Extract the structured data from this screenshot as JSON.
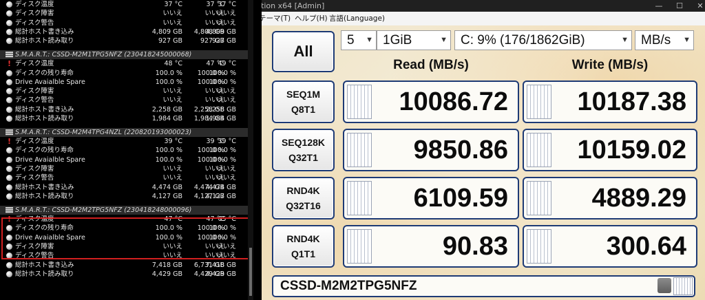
{
  "sensor_panel": {
    "top_rows": [
      {
        "icon": "gauge",
        "label": "ディスク温度",
        "v1": "37 °C",
        "v2": "37 °C",
        "v3": "37 °C"
      },
      {
        "icon": "gauge",
        "label": "ディスク障害",
        "v1": "いいえ",
        "v2": "いいえ",
        "v3": "いいえ"
      },
      {
        "icon": "gauge",
        "label": "ディスク警告",
        "v1": "いいえ",
        "v2": "いいえ",
        "v3": "いいえ"
      },
      {
        "icon": "gauge",
        "label": "総計ホスト書き込み",
        "v1": "4,809 GB",
        "v2": "4,808 GB",
        "v3": "4,809 GB"
      },
      {
        "icon": "gauge",
        "label": "総計ホスト読み取り",
        "v1": "927 GB",
        "v2": "927 GB",
        "v3": "927 GB"
      }
    ],
    "drive1": {
      "header": "S.M.A.R.T.: CSSD-M2M1TPG5NFZ (230418245000068)",
      "rows": [
        {
          "icon": "warn",
          "label": "ディスク温度",
          "v1": "48 °C",
          "v2": "47 °C",
          "v3": "49 °C"
        },
        {
          "icon": "gauge",
          "label": "ディスクの残り寿命",
          "v1": "100.0 %",
          "v2": "100.0 %",
          "v3": "100.0 %"
        },
        {
          "icon": "gauge",
          "label": "Drive Avaialble Spare",
          "v1": "100.0 %",
          "v2": "100.0 %",
          "v3": "100.0 %"
        },
        {
          "icon": "gauge",
          "label": "ディスク障害",
          "v1": "いいえ",
          "v2": "いいえ",
          "v3": "いいえ"
        },
        {
          "icon": "gauge",
          "label": "ディスク警告",
          "v1": "いいえ",
          "v2": "いいえ",
          "v3": "いいえ"
        },
        {
          "icon": "gauge",
          "label": "総計ホスト書き込み",
          "v1": "2,258 GB",
          "v2": "2,258 GB",
          "v3": "2,258 GB"
        },
        {
          "icon": "gauge",
          "label": "総計ホスト読み取り",
          "v1": "1,984 GB",
          "v2": "1,984 GB",
          "v3": "1,984 GB"
        }
      ]
    },
    "drive2": {
      "header": "S.M.A.R.T.: CSSD-M2M4TPG4NZL (220820193000023)",
      "rows": [
        {
          "icon": "warn",
          "label": "ディスク温度",
          "v1": "39 °C",
          "v2": "39 °C",
          "v3": "39 °C"
        },
        {
          "icon": "gauge",
          "label": "ディスクの残り寿命",
          "v1": "100.0 %",
          "v2": "100.0 %",
          "v3": "100.0 %"
        },
        {
          "icon": "gauge",
          "label": "Drive Avaialble Spare",
          "v1": "100.0 %",
          "v2": "100.0 %",
          "v3": "100.0 %"
        },
        {
          "icon": "gauge",
          "label": "ディスク障害",
          "v1": "いいえ",
          "v2": "いいえ",
          "v3": "いいえ"
        },
        {
          "icon": "gauge",
          "label": "ディスク警告",
          "v1": "いいえ",
          "v2": "いいえ",
          "v3": "いいえ"
        },
        {
          "icon": "gauge",
          "label": "総計ホスト書き込み",
          "v1": "4,474 GB",
          "v2": "4,474 GB",
          "v3": "4,474 GB"
        },
        {
          "icon": "gauge",
          "label": "総計ホスト読み取り",
          "v1": "4,127 GB",
          "v2": "4,127 GB",
          "v3": "4,127 GB"
        }
      ]
    },
    "drive3": {
      "header": "S.M.A.R.T.: CSSD-M2M2TPG5NFZ (230418248000096)",
      "rows": [
        {
          "icon": "warn",
          "label": "ディスク温度",
          "v1": "47 °C",
          "v2": "47 °C",
          "v3": "65 °C"
        },
        {
          "icon": "gauge",
          "label": "ディスクの残り寿命",
          "v1": "100.0 %",
          "v2": "100.0 %",
          "v3": "100.0 %"
        },
        {
          "icon": "gauge",
          "label": "Drive Avaialble Spare",
          "v1": "100.0 %",
          "v2": "100.0 %",
          "v3": "100.0 %"
        },
        {
          "icon": "gauge",
          "label": "ディスク障害",
          "v1": "いいえ",
          "v2": "いいえ",
          "v3": "いいえ"
        },
        {
          "icon": "gauge",
          "label": "ディスク警告",
          "v1": "いいえ",
          "v2": "いいえ",
          "v3": "いいえ"
        },
        {
          "icon": "gauge",
          "label": "総計ホスト書き込み",
          "v1": "7,418 GB",
          "v2": "6,731 GB",
          "v3": "7,418 GB"
        },
        {
          "icon": "gauge",
          "label": "総計ホスト読み取り",
          "v1": "4,429 GB",
          "v2": "4,429 GB",
          "v3": "4,429 GB"
        }
      ]
    },
    "highlight_color": "#d21f1f"
  },
  "cdm": {
    "title": "ition x64 [Admin]",
    "window_buttons": {
      "minimize": "—",
      "maximize": "☐",
      "close": "✕"
    },
    "menu": [
      "テーマ(T)",
      "ヘルプ(H)",
      "言語(Language)"
    ],
    "all_button": "All",
    "count": "5",
    "size": "1GiB",
    "drive": "C: 9% (176/1862GiB)",
    "unit": "MB/s",
    "read_header": "Read (MB/s)",
    "write_header": "Write (MB/s)",
    "tests": [
      {
        "line1": "SEQ1M",
        "line2": "Q8T1",
        "read": "10086.72",
        "write": "10187.38"
      },
      {
        "line1": "SEQ128K",
        "line2": "Q32T1",
        "read": "9850.86",
        "write": "10159.02"
      },
      {
        "line1": "RND4K",
        "line2": "Q32T16",
        "read": "6109.59",
        "write": "4889.29"
      },
      {
        "line1": "RND4K",
        "line2": "Q1T1",
        "read": "90.83",
        "write": "300.64"
      }
    ],
    "footer_drive": "CSSD-M2M2TPG5NFZ",
    "accent_color": "#1d3a75"
  }
}
